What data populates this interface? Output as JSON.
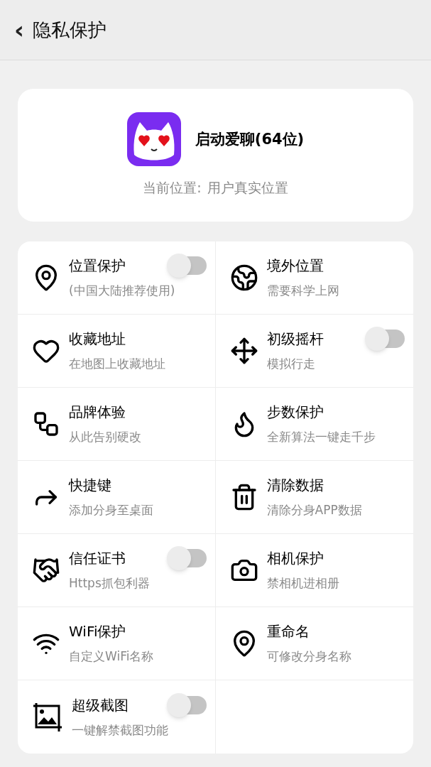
{
  "header": {
    "back": "‹",
    "title": "隐私保护"
  },
  "app_card": {
    "name": "启动爱聊(64位)",
    "location_label": "当前位置:",
    "location_value": "用户真实位置"
  },
  "features": [
    {
      "kind": "toggle",
      "title": "位置保护",
      "subtitle": "(中国大陆推荐使用)",
      "on": false
    },
    {
      "kind": "plain",
      "title": "境外位置",
      "subtitle": "需要科学上网"
    },
    {
      "kind": "plain",
      "title": "收藏地址",
      "subtitle": "在地图上收藏地址"
    },
    {
      "kind": "toggle",
      "title": "初级摇杆",
      "subtitle": "模拟行走",
      "on": false
    },
    {
      "kind": "plain",
      "title": "品牌体验",
      "subtitle": "从此告别硬改"
    },
    {
      "kind": "plain",
      "title": "步数保护",
      "subtitle": "全新算法一键走千步"
    },
    {
      "kind": "plain",
      "title": "快捷键",
      "subtitle": "添加分身至桌面"
    },
    {
      "kind": "plain",
      "title": "清除数据",
      "subtitle": "清除分身APP数据"
    },
    {
      "kind": "toggle",
      "title": "信任证书",
      "subtitle": "Https抓包利器",
      "on": false
    },
    {
      "kind": "plain",
      "title": "相机保护",
      "subtitle": "禁相机进相册"
    },
    {
      "kind": "plain",
      "title": "WiFi保护",
      "subtitle": "自定义WiFi名称"
    },
    {
      "kind": "plain",
      "title": "重命名",
      "subtitle": "可修改分身名称"
    },
    {
      "kind": "toggle",
      "title": "超级截图",
      "subtitle": "一键解禁截图功能",
      "on": false
    }
  ]
}
